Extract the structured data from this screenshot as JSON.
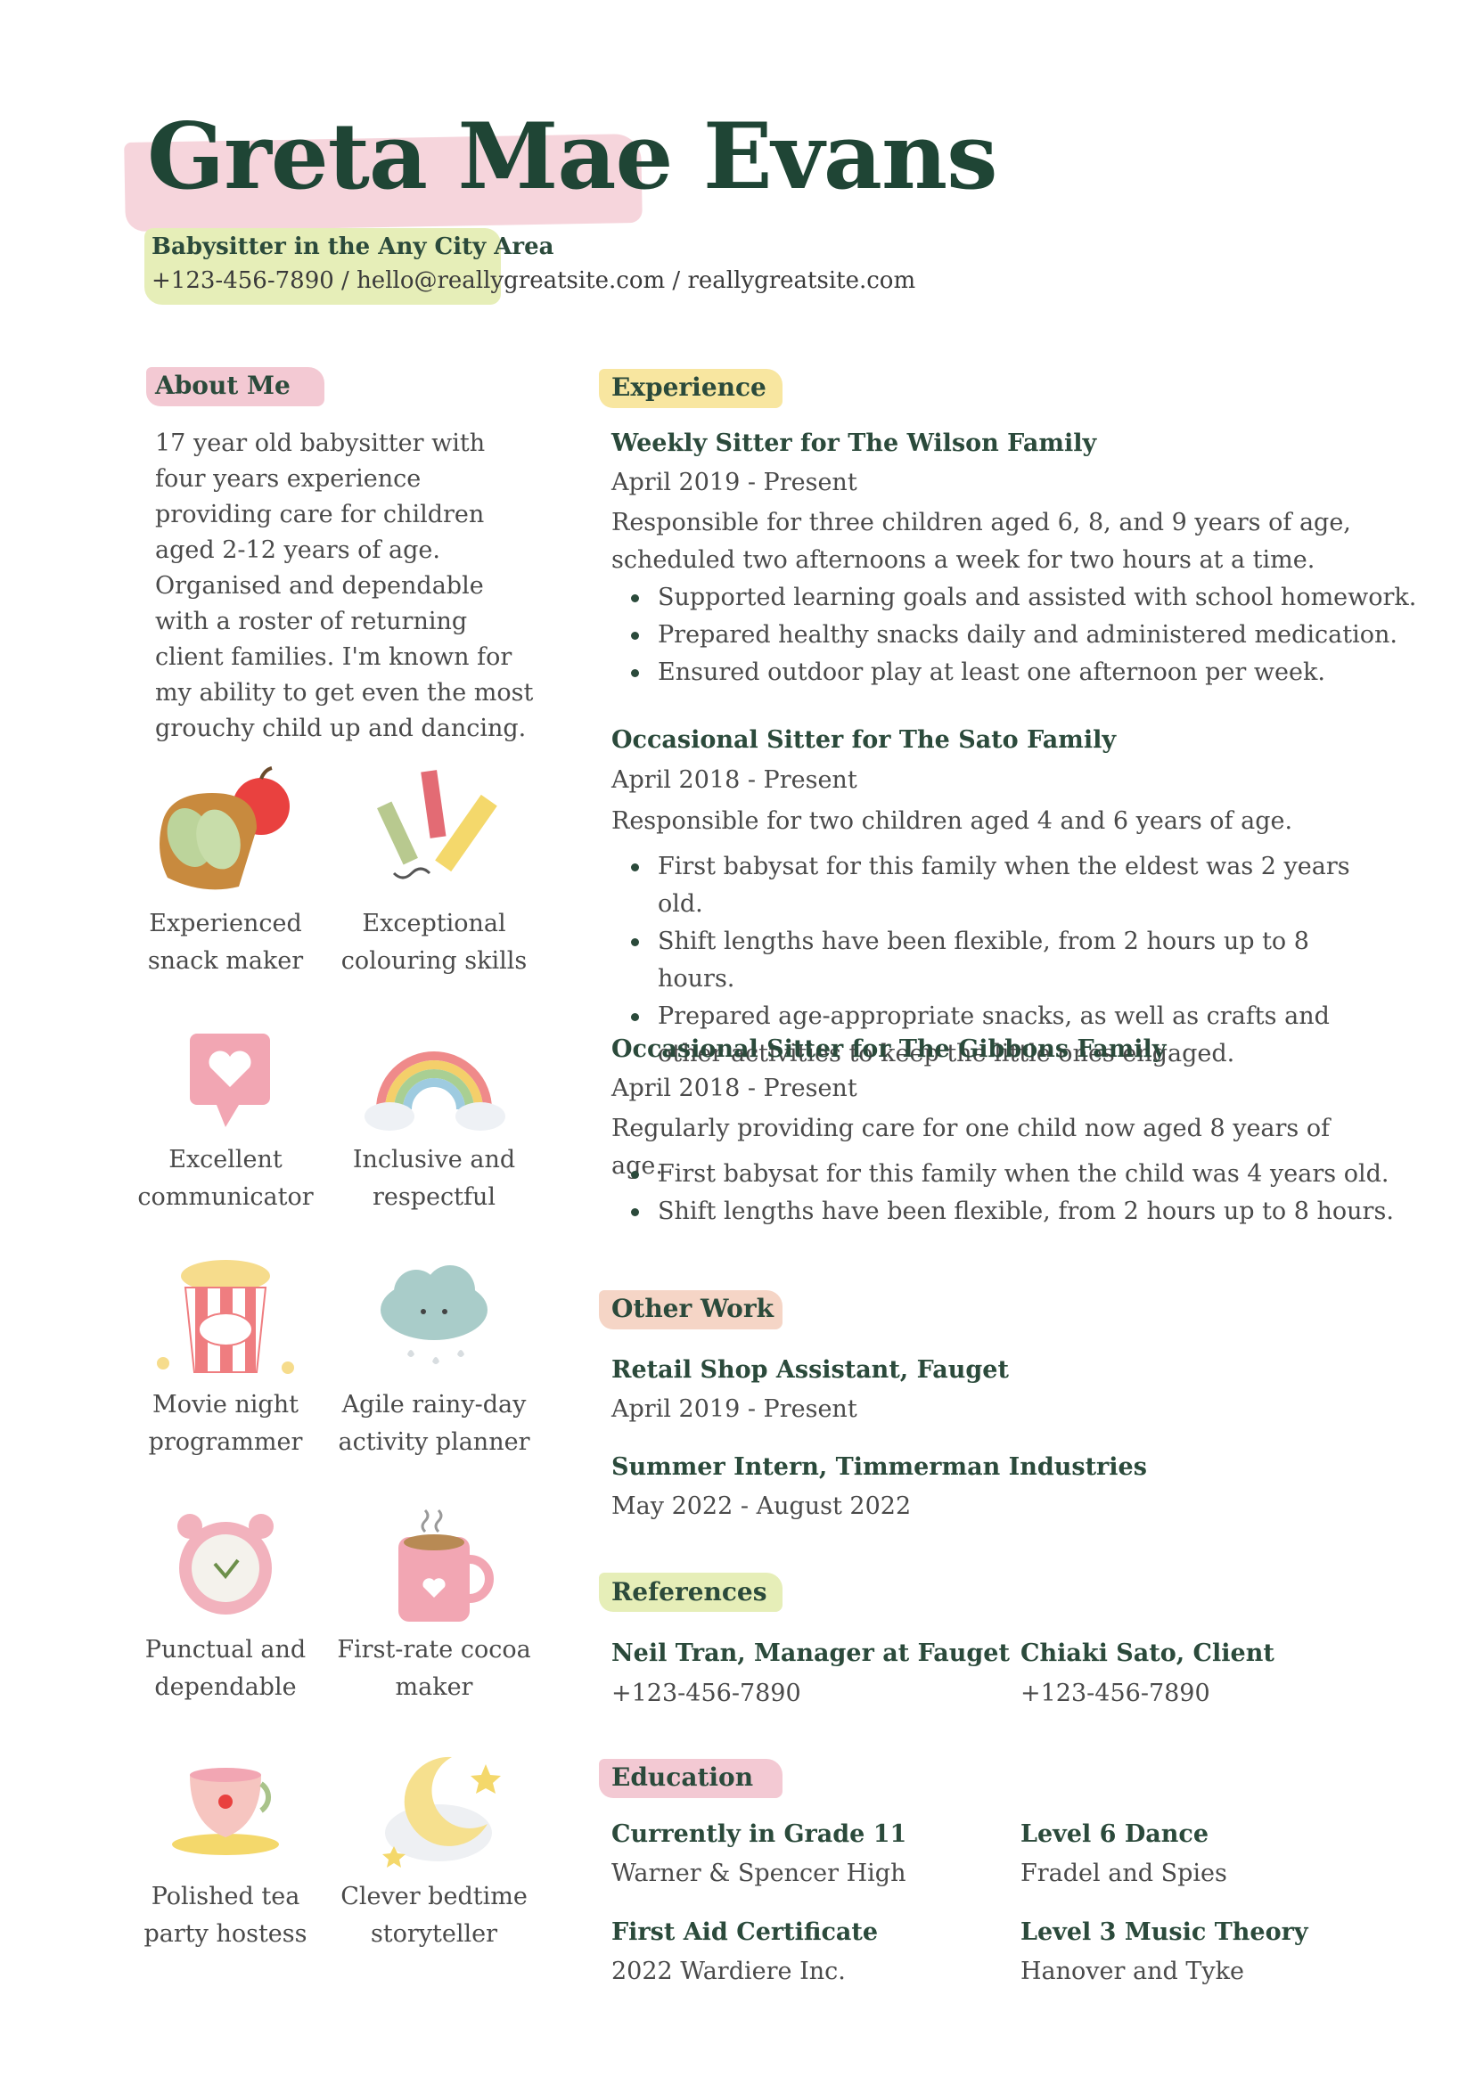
{
  "header": {
    "name": "Greta Mae Evans",
    "subtitle": "Babysitter in the Any City Area",
    "contact": "+123-456-7890 / hello@reallygreatsite.com / reallygreatsite.com"
  },
  "colors": {
    "pink": "#f6d3da",
    "yellow": "#f8e6a0",
    "lime": "#e6eeb8",
    "peach": "#f5d5c6",
    "dark_green": "#1f4535"
  },
  "about": {
    "heading": "About Me",
    "text": "17 year old babysitter with four years experience providing care for children aged 2-12 years of age. Organised and dependable with a roster of returning client families. I'm known for my ability to get even the most grouchy child up and dancing."
  },
  "skills": [
    {
      "icon": "toast-apple-icon",
      "label": "Experienced snack maker"
    },
    {
      "icon": "crayons-pencil-icon",
      "label": "Exceptional colouring skills"
    },
    {
      "icon": "heart-speech-bubble-icon",
      "label": "Excellent communicator"
    },
    {
      "icon": "rainbow-icon",
      "label": "Inclusive and respectful"
    },
    {
      "icon": "popcorn-icon",
      "label": "Movie night programmer"
    },
    {
      "icon": "rain-cloud-icon",
      "label": "Agile rainy-day activity planner"
    },
    {
      "icon": "alarm-clock-icon",
      "label": "Punctual and dependable"
    },
    {
      "icon": "cocoa-mug-icon",
      "label": "First-rate cocoa maker"
    },
    {
      "icon": "teacup-icon",
      "label": "Polished tea party hostess"
    },
    {
      "icon": "moon-stars-icon",
      "label": "Clever bedtime storyteller"
    }
  ],
  "experience": {
    "heading": "Experience",
    "jobs": [
      {
        "title": "Weekly Sitter for The Wilson Family",
        "dates": "April 2019 - Present",
        "desc": "Responsible for three children aged 6, 8, and 9 years of age, scheduled two afternoons a week for two hours at a time.",
        "bullets": [
          "Supported learning goals and assisted with school homework.",
          "Prepared healthy snacks daily and administered medication.",
          "Ensured outdoor play at least one afternoon per week."
        ]
      },
      {
        "title": "Occasional Sitter for The Sato Family",
        "dates": "April 2018 - Present",
        "desc": "Responsible for two children aged 4 and 6 years of age.",
        "bullets": [
          "First babysat for this family when the eldest was 2 years old.",
          "Shift lengths have been flexible, from 2 hours up to 8 hours.",
          "Prepared age-appropriate snacks, as well as crafts and other activities to keep the little ones engaged."
        ]
      },
      {
        "title": "Occasional Sitter for The Gibbons Family",
        "dates": "April 2018 - Present",
        "desc": "Regularly providing care for one child now aged 8 years of age.",
        "bullets": [
          "First babysat for this family when the child was 4 years old.",
          "Shift lengths have been flexible, from 2 hours up to 8 hours."
        ]
      }
    ]
  },
  "other_work": {
    "heading": "Other Work",
    "items": [
      {
        "title": "Retail Shop Assistant, Fauget",
        "dates": "April 2019 - Present"
      },
      {
        "title": "Summer Intern, Timmerman Industries",
        "dates": "May 2022 - August 2022"
      }
    ]
  },
  "references": {
    "heading": "References",
    "items": [
      {
        "name": "Neil Tran, Manager at Fauget",
        "phone": "+123-456-7890"
      },
      {
        "name": "Chiaki Sato, Client",
        "phone": "+123-456-7890"
      }
    ]
  },
  "education": {
    "heading": "Education",
    "items": [
      {
        "title": "Currently in Grade 11",
        "org": "Warner & Spencer High"
      },
      {
        "title": "Level 6 Dance",
        "org": "Fradel and Spies"
      },
      {
        "title": "First Aid Certificate",
        "org": "2022 Wardiere Inc."
      },
      {
        "title": "Level 3 Music Theory",
        "org": "Hanover and Tyke"
      }
    ]
  }
}
